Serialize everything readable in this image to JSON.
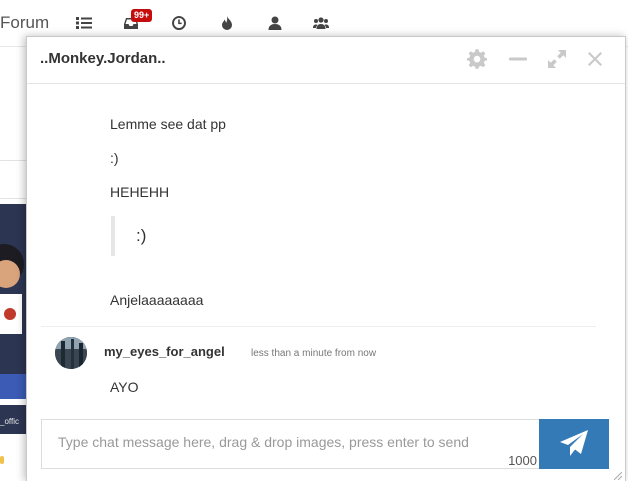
{
  "background": {
    "brand": "Forum",
    "notification_badge": "99+",
    "nav_icons": [
      "list-icon",
      "inbox-icon",
      "clock-icon",
      "fire-icon",
      "user-icon",
      "users-icon"
    ],
    "avatar_caption": "_offic"
  },
  "chat": {
    "title": "..Monkey.Jordan..",
    "header_buttons": [
      "gear-icon",
      "minimize-icon",
      "expand-icon",
      "close-icon"
    ],
    "earlier_messages": {
      "line1": "Lemme see dat pp",
      "line2": ":)",
      "line3": "HEHEHH",
      "quote": ":)",
      "line4": "Anjelaaaaaaaa"
    },
    "last_message": {
      "username": "my_eyes_for_angel",
      "timestamp": "less than a minute from now",
      "text": "AYO"
    },
    "composer": {
      "placeholder": "Type chat message here, drag & drop images, press enter to send",
      "char_count": "1000",
      "send_icon": "paper-plane-icon"
    }
  },
  "colors": {
    "accent": "#337ab7",
    "badge": "#c60d0d"
  }
}
